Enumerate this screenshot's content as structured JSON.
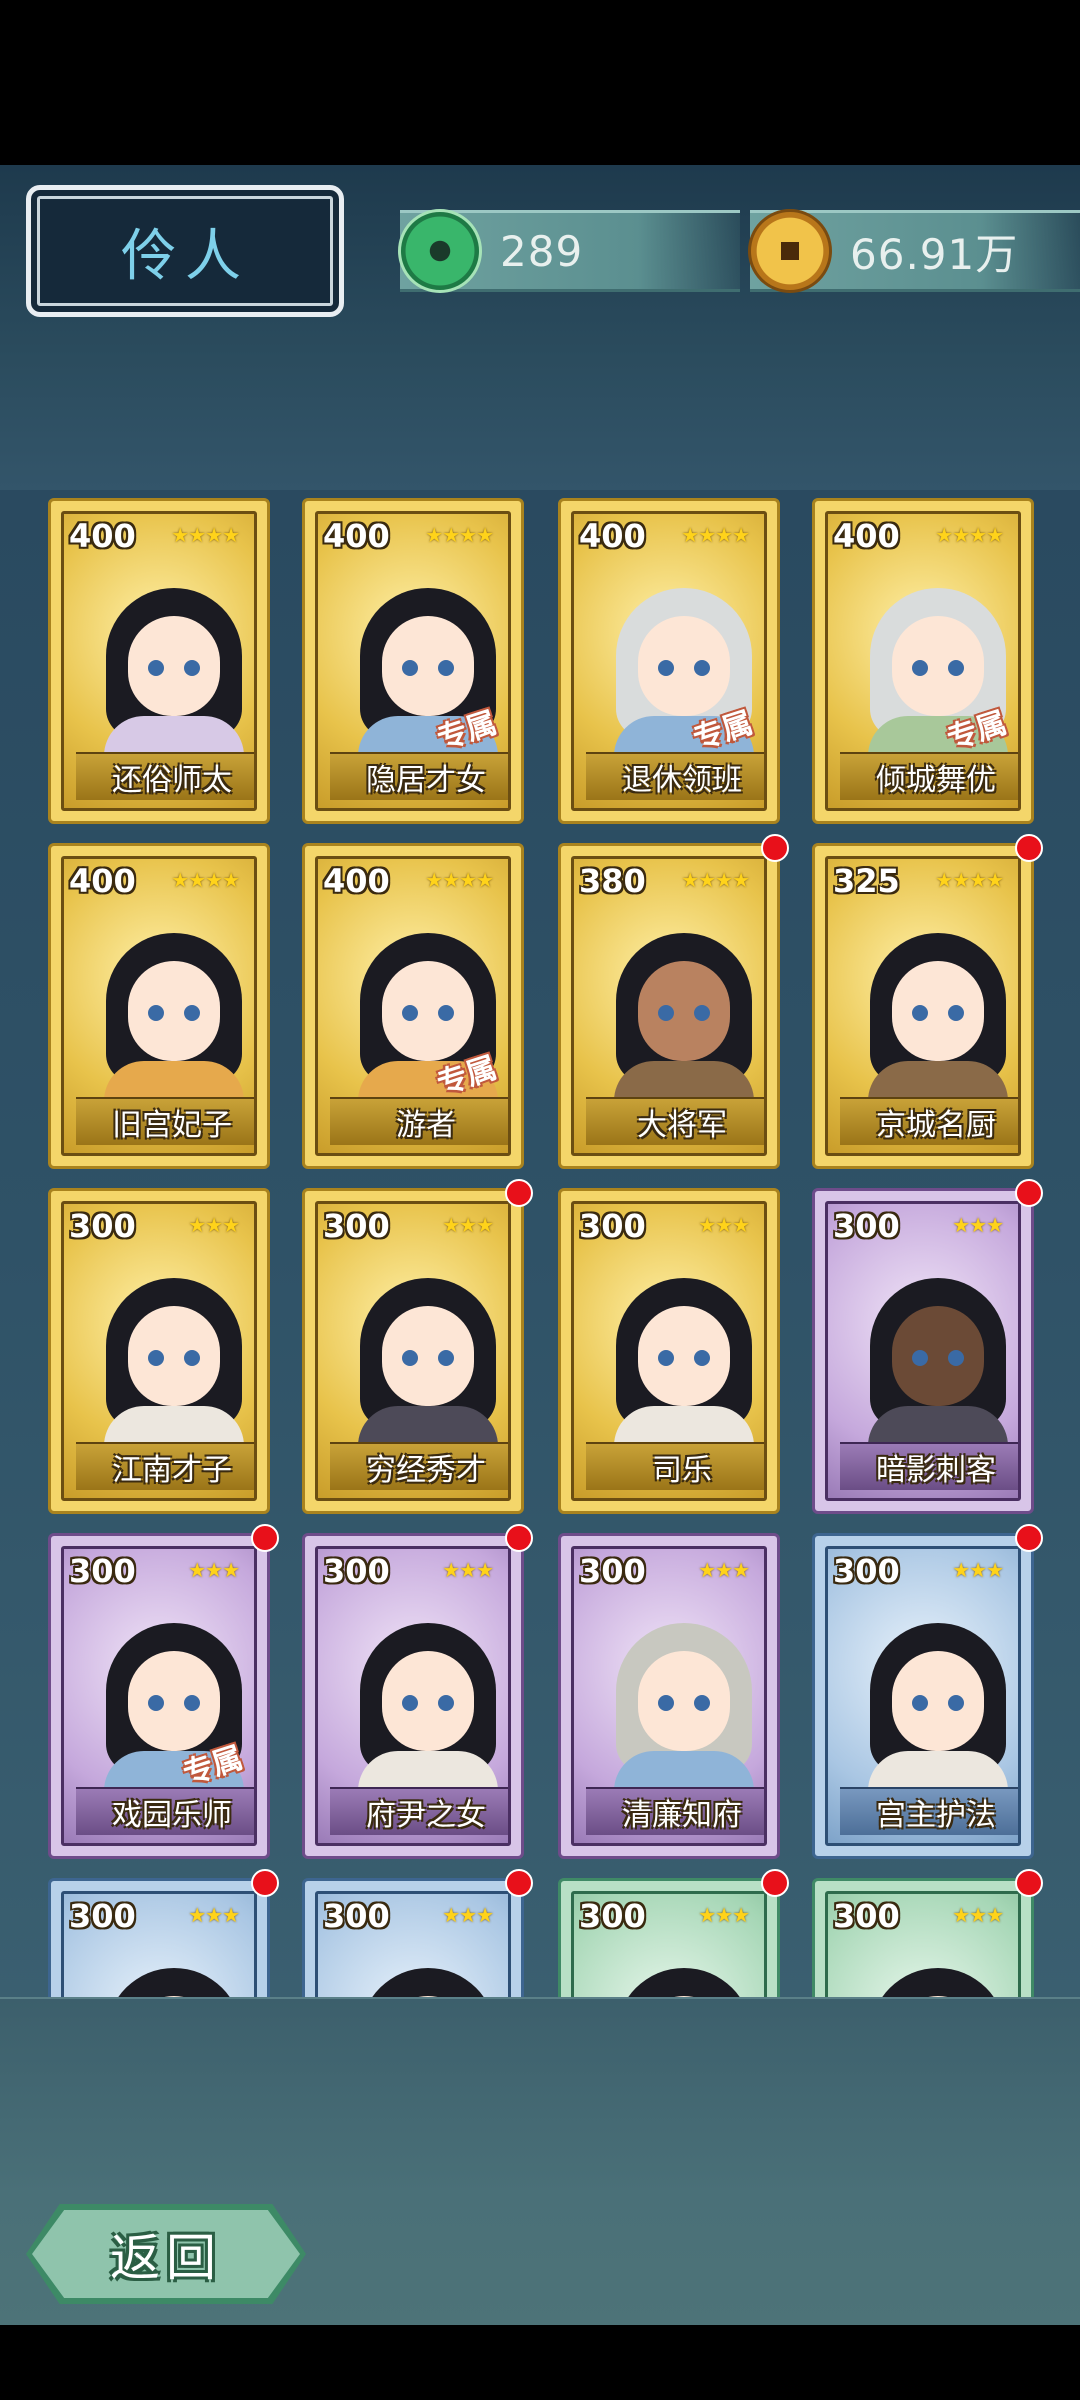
{
  "header": {
    "title": "伶人",
    "jade_value": "289",
    "coin_value": "66.91万"
  },
  "back_label": "返回",
  "exclusive_mark": "专属",
  "cards": [
    {
      "cost": "400",
      "stars": "★★★★",
      "name": "还俗师太",
      "rarity": "gold",
      "exclusive": false,
      "new": false
    },
    {
      "cost": "400",
      "stars": "★★★★",
      "name": "隐居才女",
      "rarity": "gold",
      "exclusive": true,
      "new": false
    },
    {
      "cost": "400",
      "stars": "★★★★",
      "name": "退休领班",
      "rarity": "gold",
      "exclusive": true,
      "new": false
    },
    {
      "cost": "400",
      "stars": "★★★★",
      "name": "倾城舞优",
      "rarity": "gold",
      "exclusive": true,
      "new": false
    },
    {
      "cost": "400",
      "stars": "★★★★",
      "name": "旧宫妃子",
      "rarity": "gold",
      "exclusive": false,
      "new": false
    },
    {
      "cost": "400",
      "stars": "★★★★",
      "name": "游者",
      "rarity": "gold",
      "exclusive": true,
      "new": false
    },
    {
      "cost": "380",
      "stars": "★★★★",
      "name": "大将军",
      "rarity": "gold",
      "exclusive": false,
      "new": true
    },
    {
      "cost": "325",
      "stars": "★★★★",
      "name": "京城名厨",
      "rarity": "gold",
      "exclusive": false,
      "new": true
    },
    {
      "cost": "300",
      "stars": "★★★",
      "name": "江南才子",
      "rarity": "gold",
      "exclusive": false,
      "new": false
    },
    {
      "cost": "300",
      "stars": "★★★",
      "name": "穷经秀才",
      "rarity": "gold",
      "exclusive": false,
      "new": true
    },
    {
      "cost": "300",
      "stars": "★★★",
      "name": "司乐",
      "rarity": "gold",
      "exclusive": false,
      "new": false
    },
    {
      "cost": "300",
      "stars": "★★★",
      "name": "暗影刺客",
      "rarity": "purple",
      "exclusive": false,
      "new": true
    },
    {
      "cost": "300",
      "stars": "★★★",
      "name": "戏园乐师",
      "rarity": "purple",
      "exclusive": true,
      "new": true
    },
    {
      "cost": "300",
      "stars": "★★★",
      "name": "府尹之女",
      "rarity": "purple",
      "exclusive": false,
      "new": true
    },
    {
      "cost": "300",
      "stars": "★★★",
      "name": "清廉知府",
      "rarity": "purple",
      "exclusive": false,
      "new": false
    },
    {
      "cost": "300",
      "stars": "★★★",
      "name": "宫主护法",
      "rarity": "blue",
      "exclusive": false,
      "new": true
    },
    {
      "cost": "300",
      "stars": "★★★",
      "name": "",
      "rarity": "blue",
      "exclusive": false,
      "new": true
    },
    {
      "cost": "300",
      "stars": "★★★",
      "name": "",
      "rarity": "blue",
      "exclusive": false,
      "new": true
    },
    {
      "cost": "300",
      "stars": "★★★",
      "name": "",
      "rarity": "teal",
      "exclusive": false,
      "new": true
    },
    {
      "cost": "300",
      "stars": "★★★",
      "name": "",
      "rarity": "teal",
      "exclusive": false,
      "new": true
    }
  ]
}
